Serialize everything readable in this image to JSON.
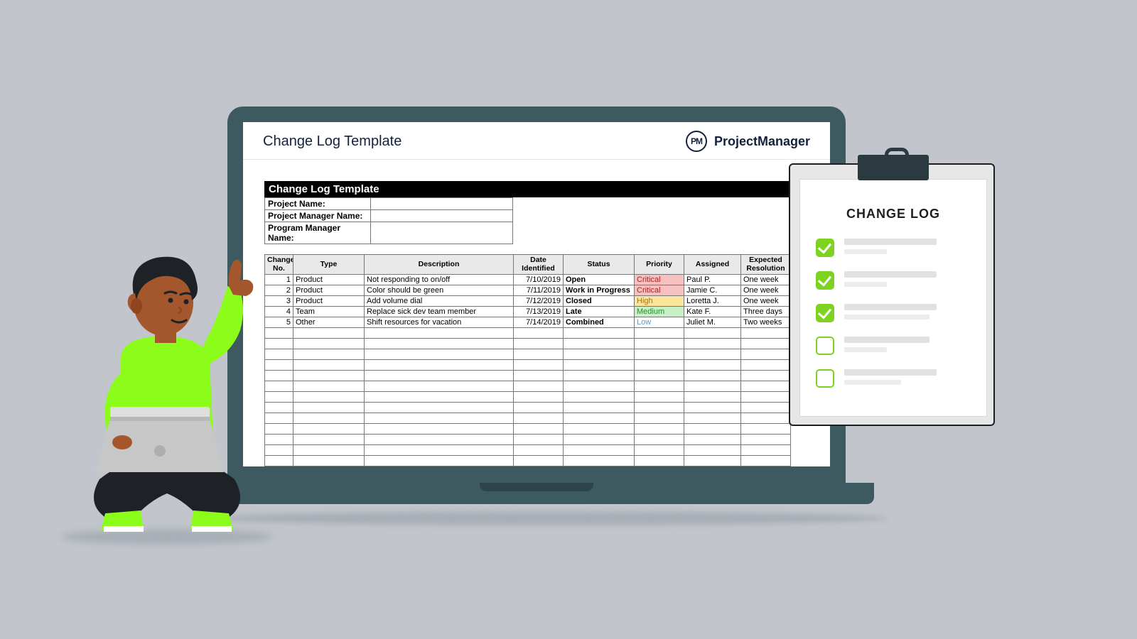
{
  "header": {
    "title": "Change Log Template",
    "brand": "ProjectManager",
    "logo_text": "PM"
  },
  "sheet": {
    "title": "Change Log Template",
    "info_fields": [
      {
        "label": "Project Name:",
        "value": ""
      },
      {
        "label": "Project Manager Name:",
        "value": ""
      },
      {
        "label": "Program Manager Name:",
        "value": ""
      }
    ],
    "columns": [
      "Change No.",
      "Type",
      "Description",
      "Date Identified",
      "Status",
      "Priority",
      "Assigned",
      "Expected Resolution"
    ],
    "rows": [
      {
        "no": "1",
        "type": "Product",
        "desc": "Not responding to on/off",
        "date": "7/10/2019",
        "status": "Open",
        "priority": "Critical",
        "pri_class": "pri-critical",
        "assigned": "Paul P.",
        "res": "One week"
      },
      {
        "no": "2",
        "type": "Product",
        "desc": "Color should be green",
        "date": "7/11/2019",
        "status": "Work in Progress",
        "priority": "Critical",
        "pri_class": "pri-critical",
        "assigned": "Jamie C.",
        "res": "One week"
      },
      {
        "no": "3",
        "type": "Product",
        "desc": "Add volume dial",
        "date": "7/12/2019",
        "status": "Closed",
        "priority": "High",
        "pri_class": "pri-high",
        "assigned": "Loretta J.",
        "res": "One week"
      },
      {
        "no": "4",
        "type": "Team",
        "desc": "Replace sick dev team member",
        "date": "7/13/2019",
        "status": "Late",
        "priority": "Medium",
        "pri_class": "pri-medium",
        "assigned": "Kate F.",
        "res": "Three days"
      },
      {
        "no": "5",
        "type": "Other",
        "desc": "Shift resources for vacation",
        "date": "7/14/2019",
        "status": "Combined",
        "priority": "Low",
        "pri_class": "pri-low",
        "assigned": "Juliet M.",
        "res": "Two weeks"
      }
    ],
    "empty_rows": 15
  },
  "clipboard": {
    "title": "CHANGE LOG",
    "items": [
      {
        "checked": true
      },
      {
        "checked": true
      },
      {
        "checked": true
      },
      {
        "checked": false
      },
      {
        "checked": false
      }
    ]
  }
}
